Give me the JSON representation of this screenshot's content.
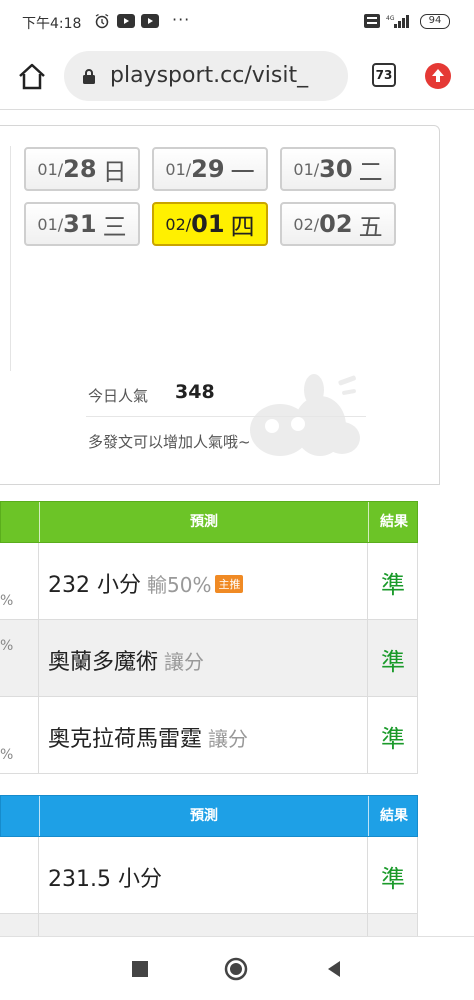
{
  "status_bar": {
    "time": "下午4:18",
    "dots": "···",
    "battery": "94",
    "icons": [
      "alarm-icon",
      "youtube-icon",
      "youtube-icon",
      "volte-icon",
      "signal-icon",
      "battery-icon"
    ]
  },
  "browser": {
    "url": "playsport.cc/visit_",
    "tab_count": "73",
    "icons": [
      "home-icon",
      "lock-icon",
      "tabs-icon",
      "update-icon"
    ]
  },
  "dates": [
    {
      "md": "01/",
      "dd": "28",
      "wd": "日",
      "active": false
    },
    {
      "md": "01/",
      "dd": "29",
      "wd": "一",
      "active": false
    },
    {
      "md": "01/",
      "dd": "30",
      "wd": "二",
      "active": false
    },
    {
      "md": "01/",
      "dd": "31",
      "wd": "三",
      "active": false
    },
    {
      "md": "02/",
      "dd": "01",
      "wd": "四",
      "active": true
    },
    {
      "md": "02/",
      "dd": "02",
      "wd": "五",
      "active": false
    }
  ],
  "popularity": {
    "label": "今日人氣",
    "value": "348",
    "hint": "多發文可以增加人氣哦~"
  },
  "table_green": {
    "color": "#6cc427",
    "headers": {
      "prediction": "預測",
      "result": "結果"
    },
    "rows": [
      {
        "pct": "%",
        "prediction": "232 小分",
        "sub": "輸50%",
        "badge": "主推",
        "result": "準"
      },
      {
        "pct": "%",
        "prediction": "奧蘭多魔術",
        "sub": "讓分",
        "badge": "",
        "result": "準"
      },
      {
        "pct": "%",
        "prediction": "奧克拉荷馬雷霆",
        "sub": "讓分",
        "badge": "",
        "result": "準"
      }
    ]
  },
  "table_blue": {
    "color": "#1ea0e6",
    "headers": {
      "prediction": "預測",
      "result": "結果"
    },
    "rows": [
      {
        "prediction": "231.5 小分",
        "result": "準"
      }
    ]
  },
  "nav": {
    "icons": [
      "recent-apps-icon",
      "home-circle-icon",
      "back-icon"
    ]
  }
}
